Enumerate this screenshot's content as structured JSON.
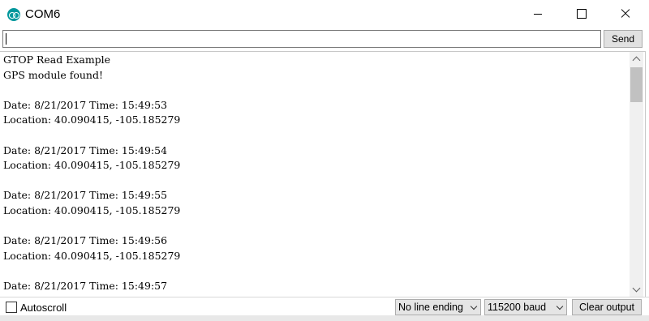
{
  "window": {
    "title": "COM6",
    "icon": "arduino-icon"
  },
  "input": {
    "value": "",
    "send_label": "Send"
  },
  "output": {
    "lines": [
      "GTOP Read Example",
      "GPS module found!",
      "",
      "Date: 8/21/2017 Time: 15:49:53",
      "Location: 40.090415, -105.185279",
      "",
      "Date: 8/21/2017 Time: 15:49:54",
      "Location: 40.090415, -105.185279",
      "",
      "Date: 8/21/2017 Time: 15:49:55",
      "Location: 40.090415, -105.185279",
      "",
      "Date: 8/21/2017 Time: 15:49:56",
      "Location: 40.090415, -105.185279",
      "",
      "Date: 8/21/2017 Time: 15:49:57"
    ]
  },
  "footer": {
    "autoscroll_label": "Autoscroll",
    "autoscroll_checked": false,
    "line_ending": "No line ending",
    "baud": "115200 baud",
    "clear_label": "Clear output"
  }
}
